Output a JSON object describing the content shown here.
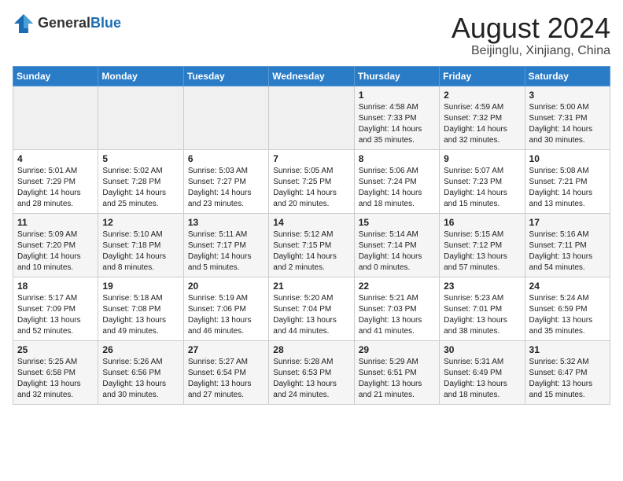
{
  "header": {
    "logo_general": "General",
    "logo_blue": "Blue",
    "month_year": "August 2024",
    "location": "Beijinglu, Xinjiang, China"
  },
  "days_of_week": [
    "Sunday",
    "Monday",
    "Tuesday",
    "Wednesday",
    "Thursday",
    "Friday",
    "Saturday"
  ],
  "weeks": [
    [
      {
        "day": "",
        "text": ""
      },
      {
        "day": "",
        "text": ""
      },
      {
        "day": "",
        "text": ""
      },
      {
        "day": "",
        "text": ""
      },
      {
        "day": "1",
        "text": "Sunrise: 4:58 AM\nSunset: 7:33 PM\nDaylight: 14 hours\nand 35 minutes."
      },
      {
        "day": "2",
        "text": "Sunrise: 4:59 AM\nSunset: 7:32 PM\nDaylight: 14 hours\nand 32 minutes."
      },
      {
        "day": "3",
        "text": "Sunrise: 5:00 AM\nSunset: 7:31 PM\nDaylight: 14 hours\nand 30 minutes."
      }
    ],
    [
      {
        "day": "4",
        "text": "Sunrise: 5:01 AM\nSunset: 7:29 PM\nDaylight: 14 hours\nand 28 minutes."
      },
      {
        "day": "5",
        "text": "Sunrise: 5:02 AM\nSunset: 7:28 PM\nDaylight: 14 hours\nand 25 minutes."
      },
      {
        "day": "6",
        "text": "Sunrise: 5:03 AM\nSunset: 7:27 PM\nDaylight: 14 hours\nand 23 minutes."
      },
      {
        "day": "7",
        "text": "Sunrise: 5:05 AM\nSunset: 7:25 PM\nDaylight: 14 hours\nand 20 minutes."
      },
      {
        "day": "8",
        "text": "Sunrise: 5:06 AM\nSunset: 7:24 PM\nDaylight: 14 hours\nand 18 minutes."
      },
      {
        "day": "9",
        "text": "Sunrise: 5:07 AM\nSunset: 7:23 PM\nDaylight: 14 hours\nand 15 minutes."
      },
      {
        "day": "10",
        "text": "Sunrise: 5:08 AM\nSunset: 7:21 PM\nDaylight: 14 hours\nand 13 minutes."
      }
    ],
    [
      {
        "day": "11",
        "text": "Sunrise: 5:09 AM\nSunset: 7:20 PM\nDaylight: 14 hours\nand 10 minutes."
      },
      {
        "day": "12",
        "text": "Sunrise: 5:10 AM\nSunset: 7:18 PM\nDaylight: 14 hours\nand 8 minutes."
      },
      {
        "day": "13",
        "text": "Sunrise: 5:11 AM\nSunset: 7:17 PM\nDaylight: 14 hours\nand 5 minutes."
      },
      {
        "day": "14",
        "text": "Sunrise: 5:12 AM\nSunset: 7:15 PM\nDaylight: 14 hours\nand 2 minutes."
      },
      {
        "day": "15",
        "text": "Sunrise: 5:14 AM\nSunset: 7:14 PM\nDaylight: 14 hours\nand 0 minutes."
      },
      {
        "day": "16",
        "text": "Sunrise: 5:15 AM\nSunset: 7:12 PM\nDaylight: 13 hours\nand 57 minutes."
      },
      {
        "day": "17",
        "text": "Sunrise: 5:16 AM\nSunset: 7:11 PM\nDaylight: 13 hours\nand 54 minutes."
      }
    ],
    [
      {
        "day": "18",
        "text": "Sunrise: 5:17 AM\nSunset: 7:09 PM\nDaylight: 13 hours\nand 52 minutes."
      },
      {
        "day": "19",
        "text": "Sunrise: 5:18 AM\nSunset: 7:08 PM\nDaylight: 13 hours\nand 49 minutes."
      },
      {
        "day": "20",
        "text": "Sunrise: 5:19 AM\nSunset: 7:06 PM\nDaylight: 13 hours\nand 46 minutes."
      },
      {
        "day": "21",
        "text": "Sunrise: 5:20 AM\nSunset: 7:04 PM\nDaylight: 13 hours\nand 44 minutes."
      },
      {
        "day": "22",
        "text": "Sunrise: 5:21 AM\nSunset: 7:03 PM\nDaylight: 13 hours\nand 41 minutes."
      },
      {
        "day": "23",
        "text": "Sunrise: 5:23 AM\nSunset: 7:01 PM\nDaylight: 13 hours\nand 38 minutes."
      },
      {
        "day": "24",
        "text": "Sunrise: 5:24 AM\nSunset: 6:59 PM\nDaylight: 13 hours\nand 35 minutes."
      }
    ],
    [
      {
        "day": "25",
        "text": "Sunrise: 5:25 AM\nSunset: 6:58 PM\nDaylight: 13 hours\nand 32 minutes."
      },
      {
        "day": "26",
        "text": "Sunrise: 5:26 AM\nSunset: 6:56 PM\nDaylight: 13 hours\nand 30 minutes."
      },
      {
        "day": "27",
        "text": "Sunrise: 5:27 AM\nSunset: 6:54 PM\nDaylight: 13 hours\nand 27 minutes."
      },
      {
        "day": "28",
        "text": "Sunrise: 5:28 AM\nSunset: 6:53 PM\nDaylight: 13 hours\nand 24 minutes."
      },
      {
        "day": "29",
        "text": "Sunrise: 5:29 AM\nSunset: 6:51 PM\nDaylight: 13 hours\nand 21 minutes."
      },
      {
        "day": "30",
        "text": "Sunrise: 5:31 AM\nSunset: 6:49 PM\nDaylight: 13 hours\nand 18 minutes."
      },
      {
        "day": "31",
        "text": "Sunrise: 5:32 AM\nSunset: 6:47 PM\nDaylight: 13 hours\nand 15 minutes."
      }
    ]
  ]
}
